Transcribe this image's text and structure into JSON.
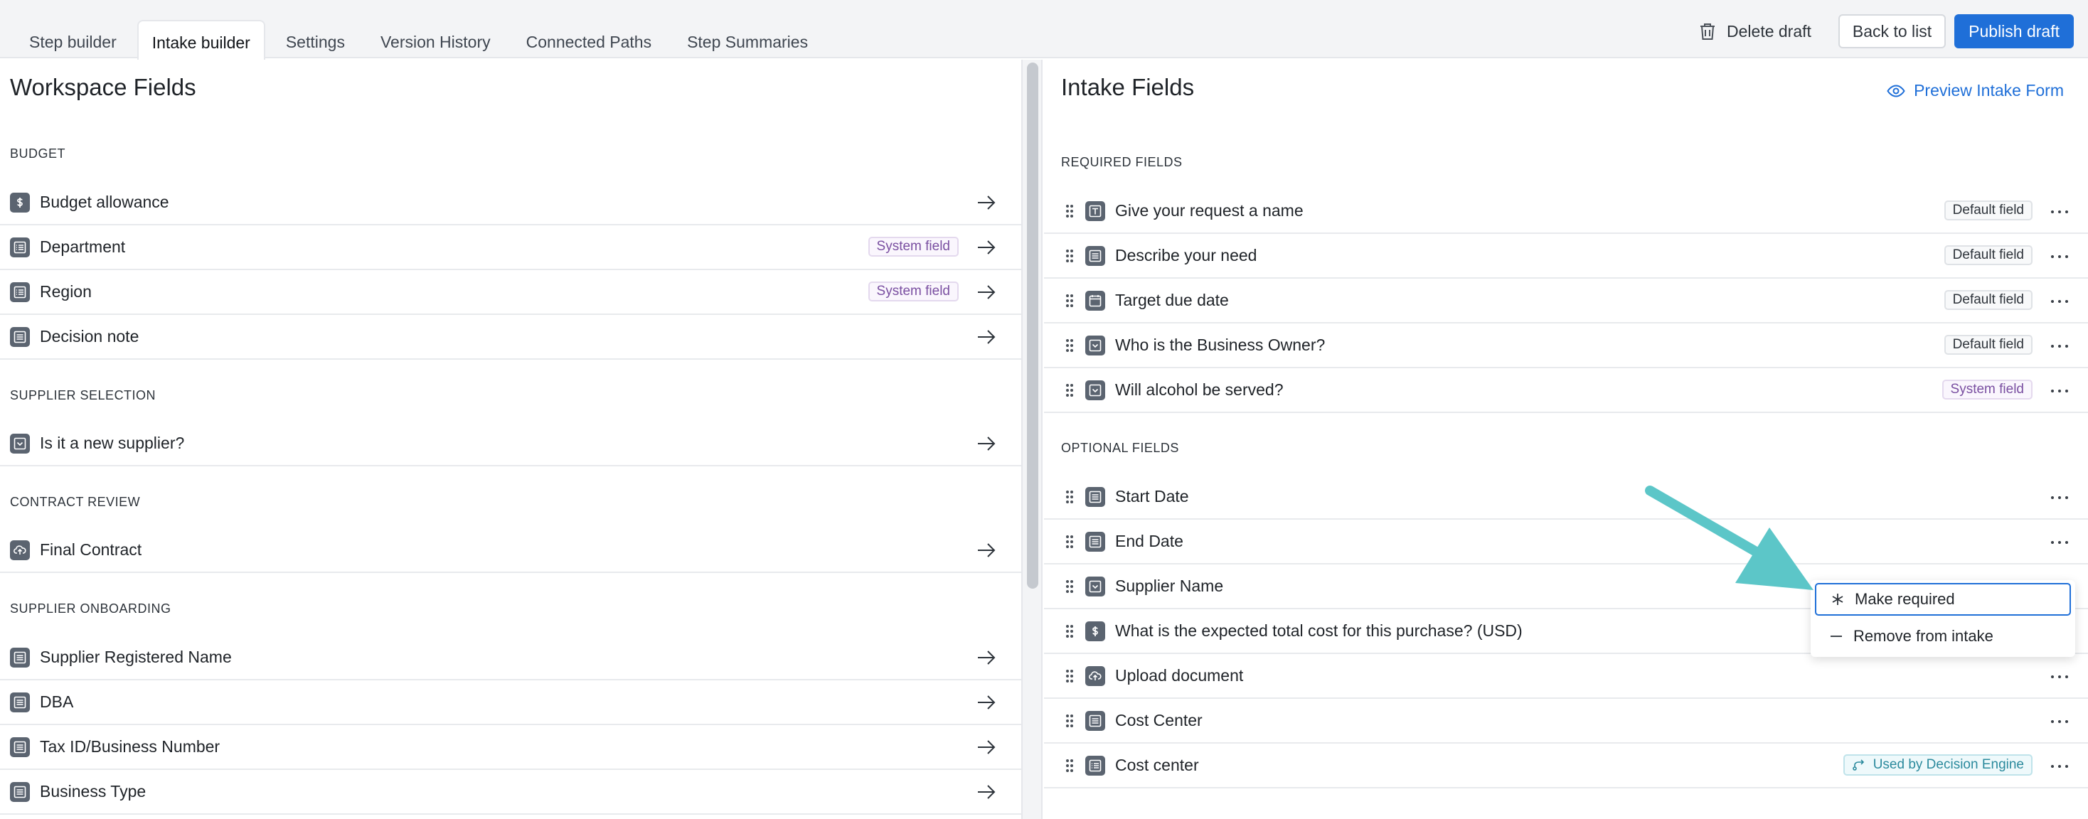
{
  "tabs": [
    {
      "label": "Step builder",
      "active": false
    },
    {
      "label": "Intake builder",
      "active": true
    },
    {
      "label": "Settings",
      "active": false
    },
    {
      "label": "Version History",
      "active": false
    },
    {
      "label": "Connected Paths",
      "active": false
    },
    {
      "label": "Step Summaries",
      "active": false
    }
  ],
  "top_actions": {
    "delete_draft": "Delete draft",
    "back_to_list": "Back to list",
    "publish_draft": "Publish draft"
  },
  "workspace": {
    "title": "Workspace Fields",
    "sections": [
      {
        "header": "BUDGET",
        "fields": [
          {
            "label": "Budget allowance",
            "icon": "currency-icon",
            "badge": ""
          },
          {
            "label": "Department",
            "icon": "list-icon",
            "badge": "System field"
          },
          {
            "label": "Region",
            "icon": "list-icon",
            "badge": "System field"
          },
          {
            "label": "Decision note",
            "icon": "text-area-icon",
            "badge": ""
          }
        ]
      },
      {
        "header": "SUPPLIER SELECTION",
        "fields": [
          {
            "label": "Is it a new supplier?",
            "icon": "dropdown-icon",
            "badge": ""
          }
        ]
      },
      {
        "header": "CONTRACT REVIEW",
        "fields": [
          {
            "label": "Final Contract",
            "icon": "upload-icon",
            "badge": ""
          }
        ]
      },
      {
        "header": "SUPPLIER ONBOARDING",
        "fields": [
          {
            "label": "Supplier Registered Name",
            "icon": "text-area-icon",
            "badge": ""
          },
          {
            "label": "DBA",
            "icon": "text-area-icon",
            "badge": ""
          },
          {
            "label": "Tax ID/Business Number",
            "icon": "text-area-icon",
            "badge": ""
          },
          {
            "label": "Business Type",
            "icon": "text-area-icon",
            "badge": ""
          }
        ]
      }
    ]
  },
  "intake": {
    "title": "Intake Fields",
    "preview_link": "Preview Intake Form",
    "required_header": "REQUIRED FIELDS",
    "optional_header": "OPTIONAL FIELDS",
    "required": [
      {
        "label": "Give your request a name",
        "icon": "text-icon",
        "badge": "Default field",
        "badge_type": "default"
      },
      {
        "label": "Describe your need",
        "icon": "text-area-icon",
        "badge": "Default field",
        "badge_type": "default"
      },
      {
        "label": "Target due date",
        "icon": "calendar-icon",
        "badge": "Default field",
        "badge_type": "default"
      },
      {
        "label": "Who is the Business Owner?",
        "icon": "dropdown-icon",
        "badge": "Default field",
        "badge_type": "default"
      },
      {
        "label": "Will alcohol be served?",
        "icon": "dropdown-icon",
        "badge": "System field",
        "badge_type": "system"
      }
    ],
    "optional": [
      {
        "label": "Start Date",
        "icon": "text-area-icon",
        "badge": "",
        "badge_type": ""
      },
      {
        "label": "End Date",
        "icon": "text-area-icon",
        "badge": "",
        "badge_type": ""
      },
      {
        "label": "Supplier Name",
        "icon": "dropdown-icon",
        "badge": "",
        "badge_type": ""
      },
      {
        "label": "What is the expected total cost for this purchase? (USD)",
        "icon": "currency-icon",
        "badge": "",
        "badge_type": ""
      },
      {
        "label": "Upload document",
        "icon": "upload-icon",
        "badge": "",
        "badge_type": ""
      },
      {
        "label": "Cost Center",
        "icon": "text-area-icon",
        "badge": "",
        "badge_type": ""
      },
      {
        "label": "Cost center",
        "icon": "list-icon",
        "badge": "Used by Decision Engine",
        "badge_type": "engine"
      }
    ]
  },
  "context_menu": {
    "items": [
      {
        "label": "Make required",
        "icon": "asterisk-icon"
      },
      {
        "label": "Remove from intake",
        "icon": "minus-icon"
      }
    ]
  },
  "colors": {
    "primary": "#1f6fd8",
    "system_badge": "#7a4fa1",
    "engine_badge": "#2b8a9d",
    "annotation_arrow": "#5cc6c8"
  }
}
